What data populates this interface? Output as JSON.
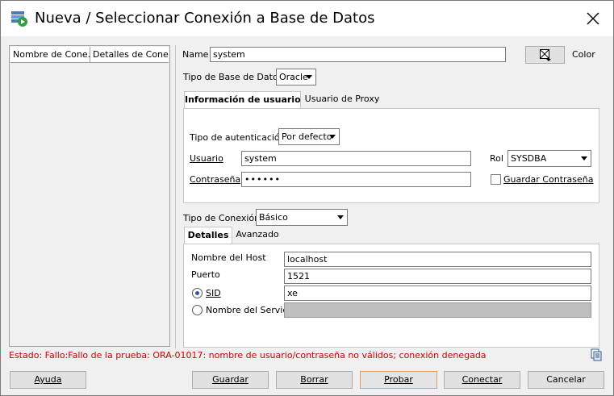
{
  "window": {
    "title": "Nueva / Seleccionar Conexión a Base de Datos"
  },
  "connections_list": {
    "columns": [
      "Nombre de Cone...",
      "Detalles de Cone..."
    ]
  },
  "form": {
    "name_label": "Name",
    "name_value": "system",
    "color_label": "Color",
    "db_type_label": "Tipo de Base de Datos",
    "db_type_value": "Oracle",
    "tabs": [
      {
        "label": "Información de usuario",
        "active": true
      },
      {
        "label": "Usuario de Proxy",
        "active": false
      }
    ],
    "auth_type_label": "Tipo de autenticación",
    "auth_type_value": "Por defecto",
    "user_label": "Usuario",
    "user_value": "system",
    "password_label": "Contraseña",
    "password_value": "••••••",
    "role_label": "Rol",
    "role_value": "SYSDBA",
    "save_password_label": "Guardar Contraseña",
    "save_password_checked": false,
    "conn_type_label": "Tipo de Conexión",
    "conn_type_value": "Básico",
    "detail_tabs": [
      {
        "label": "Detalles",
        "active": true
      },
      {
        "label": "Avanzado",
        "active": false
      }
    ],
    "host_label": "Nombre del Host",
    "host_value": "localhost",
    "port_label": "Puerto",
    "port_value": "1521",
    "sid_label": "SID",
    "sid_value": "xe",
    "service_label": "Nombre del Servicio",
    "service_value": ""
  },
  "status": {
    "text": "Estado: Fallo:Fallo de la prueba: ORA-01017: nombre de usuario/contraseña no válidos; conexión denegada",
    "color": "#d00000"
  },
  "buttons": {
    "help": "Ayuda",
    "save": "Guardar",
    "delete": "Borrar",
    "test": "Probar",
    "connect": "Conectar",
    "cancel": "Cancelar"
  }
}
